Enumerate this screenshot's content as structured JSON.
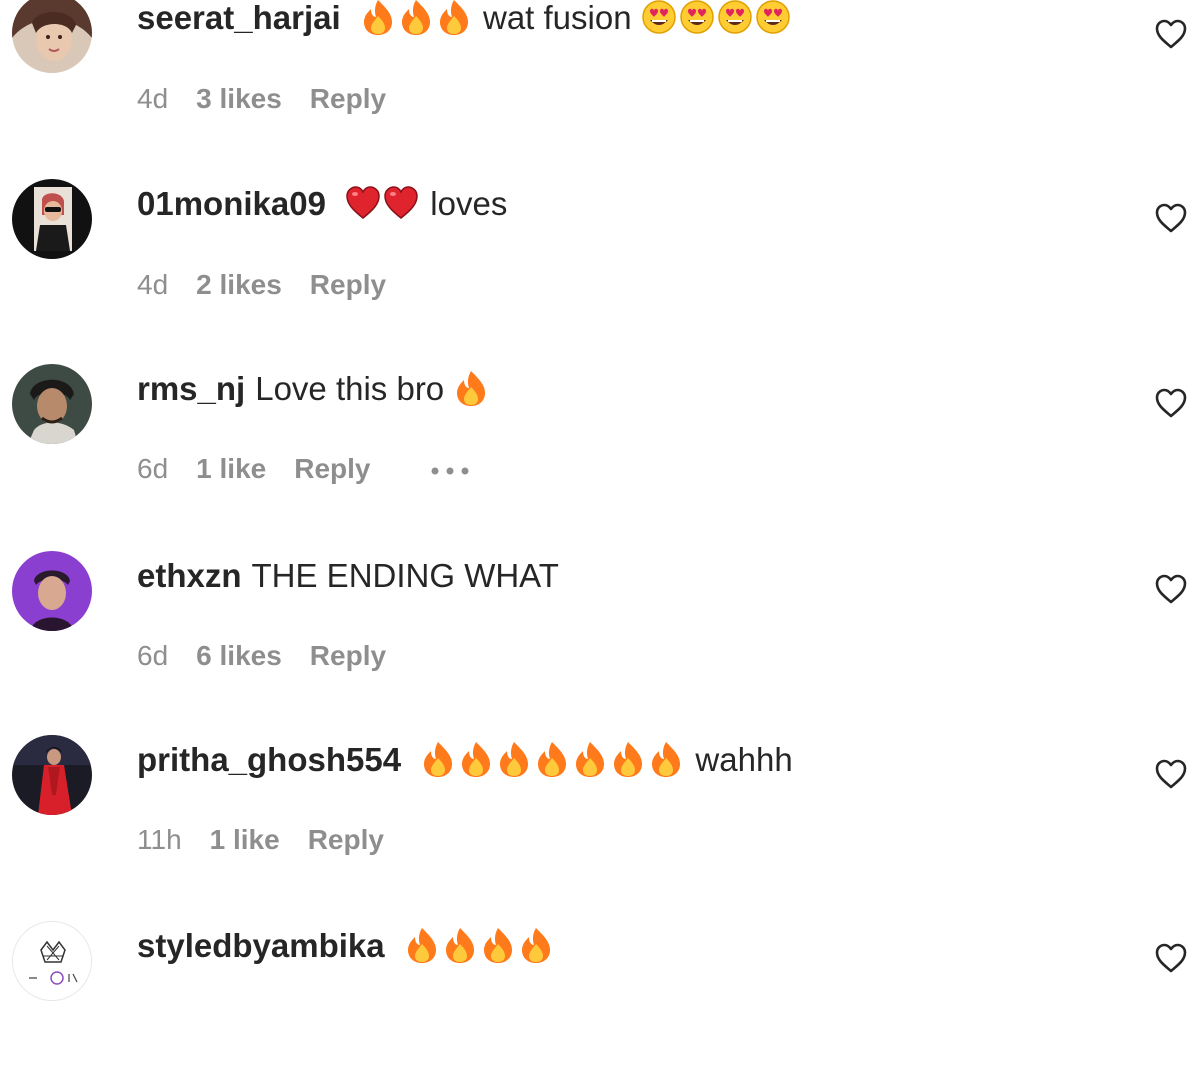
{
  "colors": {
    "username": "#262626",
    "text": "#262626",
    "meta": "#8e8e8e",
    "fire": "#ff7a1a",
    "heart_red": "#e0245e"
  },
  "comments": [
    {
      "username": "seerat_harjai",
      "emoji_before": [
        "fire",
        "fire",
        "fire"
      ],
      "text": "wat fusion",
      "emoji_after": [
        "heart-eyes",
        "heart-eyes",
        "heart-eyes",
        "heart-eyes"
      ],
      "time": "4d",
      "likes": "3 likes",
      "reply": "Reply",
      "avatar_icon": "profile-photo"
    },
    {
      "username": "01monika09",
      "emoji_before": [
        "red-heart",
        "red-heart"
      ],
      "text": "loves",
      "emoji_after": [],
      "time": "4d",
      "likes": "2 likes",
      "reply": "Reply",
      "avatar_icon": "profile-photo"
    },
    {
      "username": "rms_nj",
      "emoji_before": [],
      "text": "Love this bro",
      "emoji_after": [
        "fire"
      ],
      "time": "6d",
      "likes": "1 like",
      "reply": "Reply",
      "more_icon": "more-horizontal-icon",
      "avatar_icon": "profile-photo"
    },
    {
      "username": "ethxzn",
      "emoji_before": [],
      "text": "THE ENDING WHAT",
      "emoji_after": [],
      "time": "6d",
      "likes": "6 likes",
      "reply": "Reply",
      "avatar_icon": "profile-photo"
    },
    {
      "username": "pritha_ghosh554",
      "emoji_before": [
        "fire",
        "fire",
        "fire",
        "fire",
        "fire",
        "fire",
        "fire"
      ],
      "text": "wahhh",
      "emoji_after": [],
      "time": "11h",
      "likes": "1 like",
      "reply": "Reply",
      "avatar_icon": "profile-photo"
    },
    {
      "username": "styledbyambika",
      "emoji_before": [],
      "text": "",
      "emoji_after": [
        "fire",
        "fire",
        "fire",
        "fire"
      ],
      "avatar_icon": "brand-logo"
    }
  ]
}
